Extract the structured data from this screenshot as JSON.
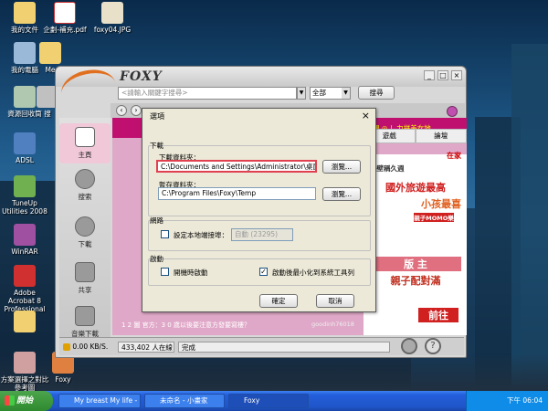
{
  "desktop": {
    "icons": [
      {
        "label": "我的文件",
        "icon": "folder-icon"
      },
      {
        "label": "企劃-補充.pdf",
        "icon": "pdf-icon"
      },
      {
        "label": "foxy04.JPG",
        "icon": "image-icon"
      },
      {
        "label": "我的電腦",
        "icon": "computer-icon"
      },
      {
        "label": "Me",
        "icon": "folder-icon"
      },
      {
        "label": "資源回收筒",
        "icon": "recycle-bin-icon"
      },
      {
        "label": "搜",
        "icon": "app-icon"
      },
      {
        "label": "ADSL",
        "icon": "network-icon"
      },
      {
        "label": "TuneUp Utilities 2008",
        "icon": "tuneup-icon"
      },
      {
        "label": "WinRAR",
        "icon": "winrar-icon"
      },
      {
        "label": "Adobe Acrobat 8 Professional",
        "icon": "acrobat-icon"
      },
      {
        "label": "",
        "icon": "folder-icon"
      },
      {
        "label": "方案選擇之對比參考圖",
        "icon": "image-icon"
      },
      {
        "label": "Foxy",
        "icon": "foxy-icon"
      }
    ]
  },
  "foxy": {
    "logo": "FOXY",
    "search_placeholder": "<請輸入關鍵字搜尋>",
    "scope": "全部",
    "search_button": "搜尋",
    "sidebar": [
      "主頁",
      "搜索",
      "下載",
      "共享",
      "音樂下載"
    ],
    "tabs": [
      "遊戲",
      "論壇"
    ],
    "banner_text": "藝舞會 - 偶 ◎ ！力拼美女地",
    "ads": [
      "在家",
      "網壁稱久週",
      "國外旅遊最高",
      "小孩最喜",
      "版 主",
      "親子配對滿",
      "前往"
    ],
    "ad_small": "親子MOMO樂",
    "list_text": "1 2 圖 官方：3 0 歲以後要注意方發要寫樓？",
    "list_author": "goodinh76018",
    "status_speed": "0.00 KB/S.",
    "status_online": "433,402 人在線",
    "status_text": "完成"
  },
  "dialog": {
    "title": "選項",
    "download_group": "下載",
    "download_folder_label": "下載資料夾：",
    "download_folder_value": "C:\\Documents and Settings\\Administrator\\桌面\\Foxy",
    "browse_label": "瀏覽...",
    "temp_folder_label": "暫存資料夾：",
    "temp_folder_value": "C:\\Program Files\\Foxy\\Temp",
    "browse_label_2": "瀏覽...",
    "network_group": "網路",
    "port_label": "設定本地端接埠：",
    "port_value": "自動 (23295)",
    "startup_group": "啟動",
    "startup_option_1": "開機時啟動",
    "startup_option_2": "啟動後最小化到系統工具列",
    "ok": "確定",
    "cancel": "取消"
  },
  "taskbar": {
    "start": "開始",
    "tasks": [
      "My breast My life - 無...",
      "未命名 - 小畫家",
      "Foxy"
    ],
    "time": "下午 06:04"
  }
}
